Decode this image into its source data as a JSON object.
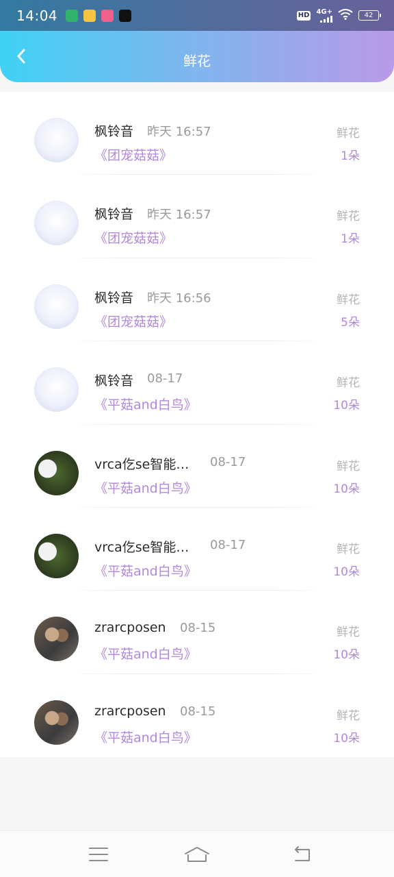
{
  "status_bar": {
    "time": "14:04",
    "network": "4G+",
    "hd": "HD",
    "battery": "42",
    "app_icons": [
      "app-1-icon",
      "app-2-icon",
      "app-3-icon",
      "tiktok-icon"
    ]
  },
  "header": {
    "title": "鲜花",
    "colors": {
      "gradient_start": "#3fd2f5",
      "gradient_end": "#b99ae8"
    }
  },
  "records": [
    {
      "name": "枫铃音",
      "time": "昨天 16:57",
      "gift": "《团宠菇菇》",
      "type": "鲜花",
      "count": "1朵",
      "avatar": "anime-avatar"
    },
    {
      "name": "枫铃音",
      "time": "昨天 16:57",
      "gift": "《团宠菇菇》",
      "type": "鲜花",
      "count": "1朵",
      "avatar": "anime-avatar"
    },
    {
      "name": "枫铃音",
      "time": "昨天 16:56",
      "gift": "《团宠菇菇》",
      "type": "鲜花",
      "count": "5朵",
      "avatar": "anime-avatar"
    },
    {
      "name": "枫铃音",
      "time": "08-17",
      "gift": "《平菇and白鸟》",
      "type": "鲜花",
      "count": "10朵",
      "avatar": "anime-avatar"
    },
    {
      "name": "vrca仡se智能…",
      "time": "08-17",
      "gift": "《平菇and白鸟》",
      "type": "鲜花",
      "count": "10朵",
      "avatar": "rabbit-avatar"
    },
    {
      "name": "vrca仡se智能…",
      "time": "08-17",
      "gift": "《平菇and白鸟》",
      "type": "鲜花",
      "count": "10朵",
      "avatar": "rabbit-avatar"
    },
    {
      "name": "zrarcposen",
      "time": "08-15",
      "gift": "《平菇and白鸟》",
      "type": "鲜花",
      "count": "10朵",
      "avatar": "couple-avatar"
    },
    {
      "name": "zrarcposen",
      "time": "08-15",
      "gift": "《平菇and白鸟》",
      "type": "鲜花",
      "count": "10朵",
      "avatar": "couple-avatar"
    }
  ],
  "colors": {
    "accent": "#b188dd",
    "muted": "#9a9a9a"
  }
}
